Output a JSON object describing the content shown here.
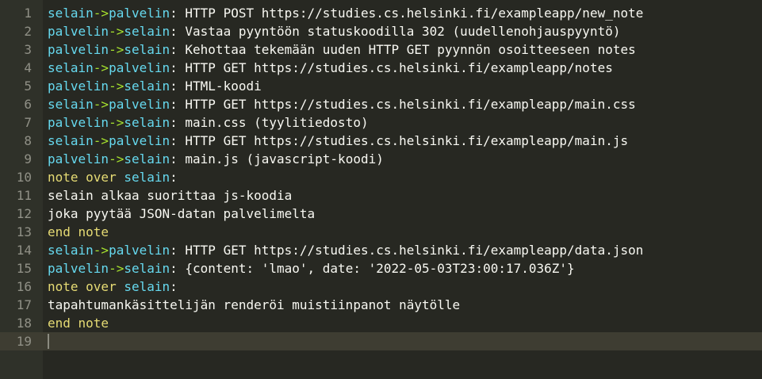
{
  "editor": {
    "lines": [
      {
        "n": "1",
        "from": "selain",
        "arrow": "->",
        "to": "palvelin",
        "colon": ":",
        "text": " HTTP POST https://studies.cs.helsinki.fi/exampleapp/new_note"
      },
      {
        "n": "2",
        "from": "palvelin",
        "arrow": "->",
        "to": "selain",
        "colon": ":",
        "text": " Vastaa pyyntöön statuskoodilla 302 (uudellenohjauspyyntö)"
      },
      {
        "n": "3",
        "from": "palvelin",
        "arrow": "->",
        "to": "selain",
        "colon": ":",
        "text": " Kehottaa tekemään uuden HTTP GET pyynnön osoitteeseen notes"
      },
      {
        "n": "4",
        "from": "selain",
        "arrow": "->",
        "to": "palvelin",
        "colon": ":",
        "text": " HTTP GET https://studies.cs.helsinki.fi/exampleapp/notes"
      },
      {
        "n": "5",
        "from": "palvelin",
        "arrow": "->",
        "to": "selain",
        "colon": ":",
        "text": " HTML-koodi"
      },
      {
        "n": "6",
        "from": "selain",
        "arrow": "->",
        "to": "palvelin",
        "colon": ":",
        "text": " HTTP GET https://studies.cs.helsinki.fi/exampleapp/main.css"
      },
      {
        "n": "7",
        "from": "palvelin",
        "arrow": "->",
        "to": "selain",
        "colon": ":",
        "text": " main.css (tyylitiedosto)"
      },
      {
        "n": "8",
        "from": "selain",
        "arrow": "->",
        "to": "palvelin",
        "colon": ":",
        "text": " HTTP GET https://studies.cs.helsinki.fi/exampleapp/main.js"
      },
      {
        "n": "9",
        "from": "palvelin",
        "arrow": "->",
        "to": "selain",
        "colon": ":",
        "text": " main.js (javascript-koodi)"
      },
      {
        "n": "10",
        "kw1": "note over",
        "actor": " selain",
        "colon": ":"
      },
      {
        "n": "11",
        "plain": "selain alkaa suorittaa js-koodia"
      },
      {
        "n": "12",
        "plain": "joka pyytää JSON-datan palvelimelta"
      },
      {
        "n": "13",
        "kw1": "end note"
      },
      {
        "n": "14",
        "from": "selain",
        "arrow": "->",
        "to": "palvelin",
        "colon": ":",
        "text": " HTTP GET https://studies.cs.helsinki.fi/exampleapp/data.json"
      },
      {
        "n": "15",
        "from": "palvelin",
        "arrow": "->",
        "to": "selain",
        "colon": ":",
        "text": " {content: 'lmao', date: '2022-05-03T23:00:17.036Z'}"
      },
      {
        "n": "16",
        "kw1": "note over",
        "actor": " selain",
        "colon": ":"
      },
      {
        "n": "17",
        "plain": "tapahtumankäsittelijän renderöi muistiinpanot näytölle"
      },
      {
        "n": "18",
        "kw1": "end note"
      },
      {
        "n": "19",
        "plain": ""
      }
    ],
    "active_line": "19"
  },
  "colors": {
    "background": "#272822",
    "gutter": "#2f3129",
    "line_number": "#909086",
    "actor": "#66d9ef",
    "arrow": "#a6e22e",
    "keyword": "#e6db74",
    "text": "#f8f8f2",
    "active_line": "#3e3d32"
  }
}
